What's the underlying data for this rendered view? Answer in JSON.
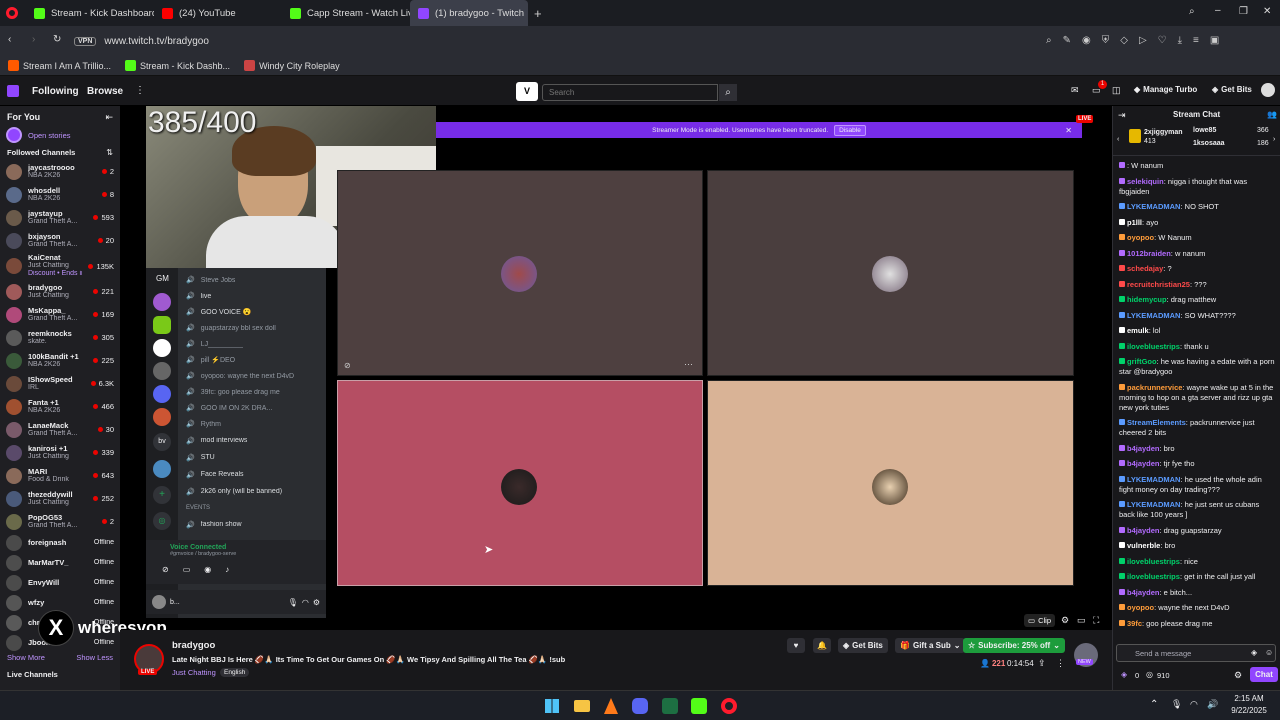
{
  "tabs": [
    {
      "label": "Stream - Kick Dashboard",
      "color": "#53fc18"
    },
    {
      "label": "(24) YouTube",
      "color": "#ff0000"
    },
    {
      "label": "Capp Stream - Watch Live",
      "color": "#53fc18"
    },
    {
      "label": "(1) bradygoo - Twitch",
      "color": "#9146ff"
    }
  ],
  "address": {
    "vpn": "VPN",
    "url": "www.twitch.tv/bradygoo"
  },
  "bookmarks": [
    "Stream I Am A Trillio...",
    "Stream - Kick Dashb...",
    "Windy City Roleplay"
  ],
  "twitch_nav": {
    "following": "Following",
    "browse": "Browse",
    "search_placeholder": "Search",
    "manage_turbo": "Manage Turbo",
    "get_bits": "Get Bits",
    "notif_count": "1"
  },
  "sidebar": {
    "for_you": "For You",
    "open_stories": "Open stories",
    "followed": "Followed Channels",
    "channels": [
      {
        "name": "jaycastroooo",
        "game": "NBA 2K26",
        "viewers": "2",
        "color": "#8a6a5a"
      },
      {
        "name": "whosdell",
        "game": "NBA 2K26",
        "viewers": "8",
        "color": "#5a6a8a"
      },
      {
        "name": "jaystayup",
        "game": "Grand Theft A...",
        "viewers": "593",
        "color": "#6a5a4a"
      },
      {
        "name": "bxjayson",
        "game": "Grand Theft A...",
        "viewers": "20",
        "color": "#4a4a5a"
      },
      {
        "name": "KaiCenat",
        "game": "Just Chatting",
        "viewers": "135K",
        "color": "#7a4a3a",
        "extra": "Discount • Ends in 7!"
      },
      {
        "name": "bradygoo",
        "game": "Just Chatting",
        "viewers": "221",
        "color": "#a05a5a"
      },
      {
        "name": "MsKappa_",
        "game": "Grand Theft A...",
        "viewers": "169",
        "color": "#b04a7a"
      },
      {
        "name": "reemknocks",
        "game": "skate.",
        "viewers": "305",
        "color": "#5a5a5a"
      },
      {
        "name": "100kBandit +1",
        "game": "NBA 2K26",
        "viewers": "225",
        "color": "#3a5a3a"
      },
      {
        "name": "IShowSpeed",
        "game": "IRL",
        "viewers": "6.3K",
        "color": "#6a4a3a"
      },
      {
        "name": "Fanta +1",
        "game": "NBA 2K26",
        "viewers": "466",
        "color": "#a05030"
      },
      {
        "name": "LanaeMack",
        "game": "Grand Theft A...",
        "viewers": "30",
        "color": "#7a5a6a"
      },
      {
        "name": "kanirosi +1",
        "game": "Just Chatting",
        "viewers": "339",
        "color": "#5a4a6a"
      },
      {
        "name": "MARI",
        "game": "Food & Drink",
        "viewers": "643",
        "color": "#8a6a5a"
      },
      {
        "name": "thezeddywill",
        "game": "Just Chatting",
        "viewers": "252",
        "color": "#4a5a7a"
      },
      {
        "name": "PopOG53",
        "game": "Grand Theft A...",
        "viewers": "2",
        "color": "#6a6a4a"
      }
    ],
    "offline": [
      {
        "name": "foreignash",
        "status": "Offline",
        "color": "#4a4a4a"
      },
      {
        "name": "MarMarTV_",
        "status": "Offline",
        "color": "#5a4a4a"
      },
      {
        "name": "EnvyWill",
        "status": "Offline",
        "color": "#4a4a5a"
      },
      {
        "name": "wfzy",
        "status": "Offline",
        "color": "#4a5a4a"
      },
      {
        "name": "chr",
        "status": "Offline",
        "color": "#5a5a4a"
      },
      {
        "name": "Jboom",
        "status": "Offline",
        "color": "#4a4a4a"
      }
    ],
    "show_more": "Show More",
    "show_less": "Show Less",
    "live_channels": "Live Channels"
  },
  "stream": {
    "counter": "385/400",
    "banner": "Streamer Mode is enabled. Usernames have been truncated.",
    "disable": "Disable",
    "live": "LIVE",
    "watermark": "wheresyop",
    "clip": "Clip",
    "voice": {
      "server_initial": "GM",
      "connected": "Voice Connected",
      "connected_sub": "#gmvoice / bradygoo-serve",
      "events": "EVENTS",
      "rows": [
        "Steve Jobs",
        "live",
        "GOO VOICE 😮",
        "guapstarzay bbl sex doll",
        "LJ_________",
        "pill ⚡DEO",
        "oyopoo: wayne the next D4vD",
        "39fc: goo please drag me",
        "GOO IM ON 2K DRA...",
        "Rythm",
        "mod interviews",
        "STU",
        "Face Reveals",
        "2k26 only (will be banned)",
        "fashion show"
      ],
      "user": "b..."
    }
  },
  "info": {
    "channel": "bradygoo",
    "title": "Late Night BBJ Is Here 🏈🙏🏻 Its Time To Get Our Games On 🏈🙏🏻 We Tipsy And Spilling All The Tea 🏈🙏🏻 !sub",
    "category": "Just Chatting",
    "tag": "English",
    "live": "LIVE",
    "get_bits": "Get Bits",
    "gift": "Gift a Sub",
    "subscribe": "Subscribe: 25% off",
    "viewers": "221",
    "uptime": "0:14:54",
    "new": "NEW"
  },
  "chat": {
    "header": "Stream Chat",
    "top": [
      {
        "name": "2xjiggyman",
        "val": "413"
      },
      {
        "name": "lowe85",
        "val": "366"
      },
      {
        "name": "1ksosaaa",
        "val": "186"
      }
    ],
    "messages": [
      {
        "u": "",
        "t": ": W nanum",
        "c": "#b26bff"
      },
      {
        "u": "selekiquin",
        "t": ": nigga i thought that was fbgjaiden",
        "c": "#b26bff"
      },
      {
        "u": "LYKEMADMAN",
        "t": ": NO SHOT",
        "c": "#5b9bff"
      },
      {
        "u": "p1lll",
        "t": ": ayo",
        "c": "#fff"
      },
      {
        "u": "oyopoo",
        "t": ": W Nanum",
        "c": "#ff9c3a"
      },
      {
        "u": "1012braiden",
        "t": ": w nanum",
        "c": "#b26bff"
      },
      {
        "u": "schedajay",
        "t": ": ?",
        "c": "#ff4a4a"
      },
      {
        "u": "recruitchristian25",
        "t": ": ???",
        "c": "#ff4a4a"
      },
      {
        "u": "hidemycup",
        "t": ": drag matthew",
        "c": "#00d26a"
      },
      {
        "u": "LYKEMADMAN",
        "t": ": SO WHAT????",
        "c": "#5b9bff"
      },
      {
        "u": "emulk",
        "t": ": lol",
        "c": "#fff"
      },
      {
        "u": "ilovebluestrips",
        "t": ": thank u",
        "c": "#00d26a"
      },
      {
        "u": "griftGoo",
        "t": ": he was having a edate with a porn star @bradygoo",
        "c": "#00d26a"
      },
      {
        "u": "packrunnervice",
        "t": ": wayne wake up at 5 in the morning to hop on a gta server and rizz up gta new york tuties",
        "c": "#ff9c3a"
      },
      {
        "u": "StreamElements",
        "t": ": packrunnervice just cheered 2 bits",
        "c": "#5b9bff"
      },
      {
        "u": "b4jayden",
        "t": ": bro",
        "c": "#b26bff"
      },
      {
        "u": "b4jayden",
        "t": ": tjr fye tho",
        "c": "#b26bff"
      },
      {
        "u": "LYKEMADMAN",
        "t": ": he used the whole adin fight money on day trading???",
        "c": "#5b9bff"
      },
      {
        "u": "LYKEMADMAN",
        "t": ": he just sent us cubans back like 100 years ]",
        "c": "#5b9bff"
      },
      {
        "u": "b4jayden",
        "t": ": drag guapstarzay",
        "c": "#b26bff"
      },
      {
        "u": "vulnerble",
        "t": ": bro",
        "c": "#fff"
      },
      {
        "u": "ilovebluestrips",
        "t": ": nice",
        "c": "#00d26a"
      },
      {
        "u": "ilovebluestrips",
        "t": ": get in the call just yall",
        "c": "#00d26a"
      },
      {
        "u": "b4jayden",
        "t": ": e bitch...",
        "c": "#b26bff"
      },
      {
        "u": "oyopoo",
        "t": ": wayne the next D4vD",
        "c": "#ff9c3a"
      },
      {
        "u": "39fc",
        "t": ": goo please drag me",
        "c": "#ff9c3a"
      }
    ],
    "placeholder": "Send a message",
    "points": "0",
    "bits": "910",
    "chat_btn": "Chat"
  },
  "taskbar": {
    "time": "2:15 AM",
    "date": "9/22/2025"
  }
}
